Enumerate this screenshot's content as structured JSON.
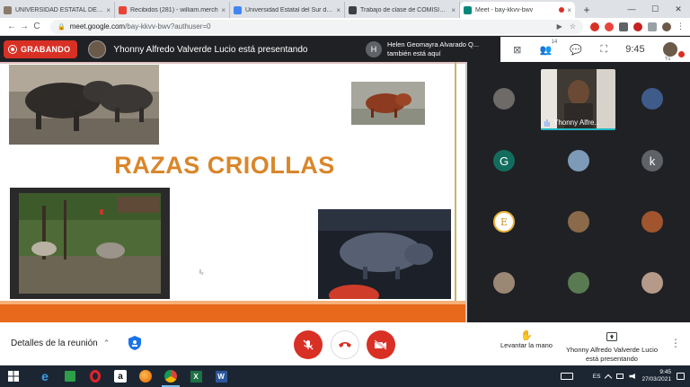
{
  "browser": {
    "tabs": [
      {
        "title": "UNIVERSIDAD ESTATAL DEL SUR",
        "fav_color": "#8a7a6a",
        "active": false
      },
      {
        "title": "Recibidos (281) - william.merch",
        "fav_color": "#ea4335",
        "active": false
      },
      {
        "title": "Universidad Estatal del Sur de M",
        "fav_color": "#4285f4",
        "active": false
      },
      {
        "title": "Trabajo de clase de COMISIÓN",
        "fav_color": "#3c4043",
        "active": false
      },
      {
        "title": "Meet - bay-kkvv-bwv",
        "fav_color": "#00897b",
        "active": true
      }
    ],
    "new_tab": "+",
    "close_glyph": "×",
    "window_controls": {
      "minimize": "—",
      "maximize": "☐",
      "close": "✕"
    },
    "nav": {
      "back": "←",
      "forward": "→",
      "reload": "C"
    },
    "url_host": "meet.google.com",
    "url_path": "/bay-kkvv-bwv?authuser=0",
    "url_actions": {
      "camera": "▶",
      "star": "☆"
    }
  },
  "meet": {
    "recording_label": "GRABANDO",
    "presenting_text": "Yhonny Alfredo Valverde Lucio está presentando",
    "toast": {
      "initial": "H",
      "line1": "Helen Geomayra Alvarado Q...",
      "line2": "también está aquí"
    },
    "participants_count": "14",
    "clock": "9:45",
    "self_label": "Tú",
    "icons": {
      "layout": "⊠",
      "people": "👥",
      "chat": "💬",
      "activities": "⛶"
    }
  },
  "slide": {
    "title": "RAZAS CRIOLLAS",
    "cursor_text": "I₂"
  },
  "grid": {
    "selfview_name": "Yhonny Alfre...",
    "letter_tiles": [
      "G",
      "k"
    ],
    "e_tile": "E"
  },
  "bottom": {
    "meeting_details": "Detalles de la reunión",
    "chevron": "⌃",
    "raise_hand": "Levantar la mano",
    "presenting_line1": "Yhonny Alfredo Valverde Lucio",
    "presenting_line2": "está presentando",
    "more_glyph": "⋮",
    "hand_glyph": "✋"
  },
  "taskbar": {
    "lang": "ES",
    "time": "9:45",
    "date": "27/03/2021"
  },
  "colors": {
    "recording_red": "#d93025",
    "title_orange": "#d9862a",
    "slide_band": "#e8691b",
    "dark_bg": "#202124"
  }
}
